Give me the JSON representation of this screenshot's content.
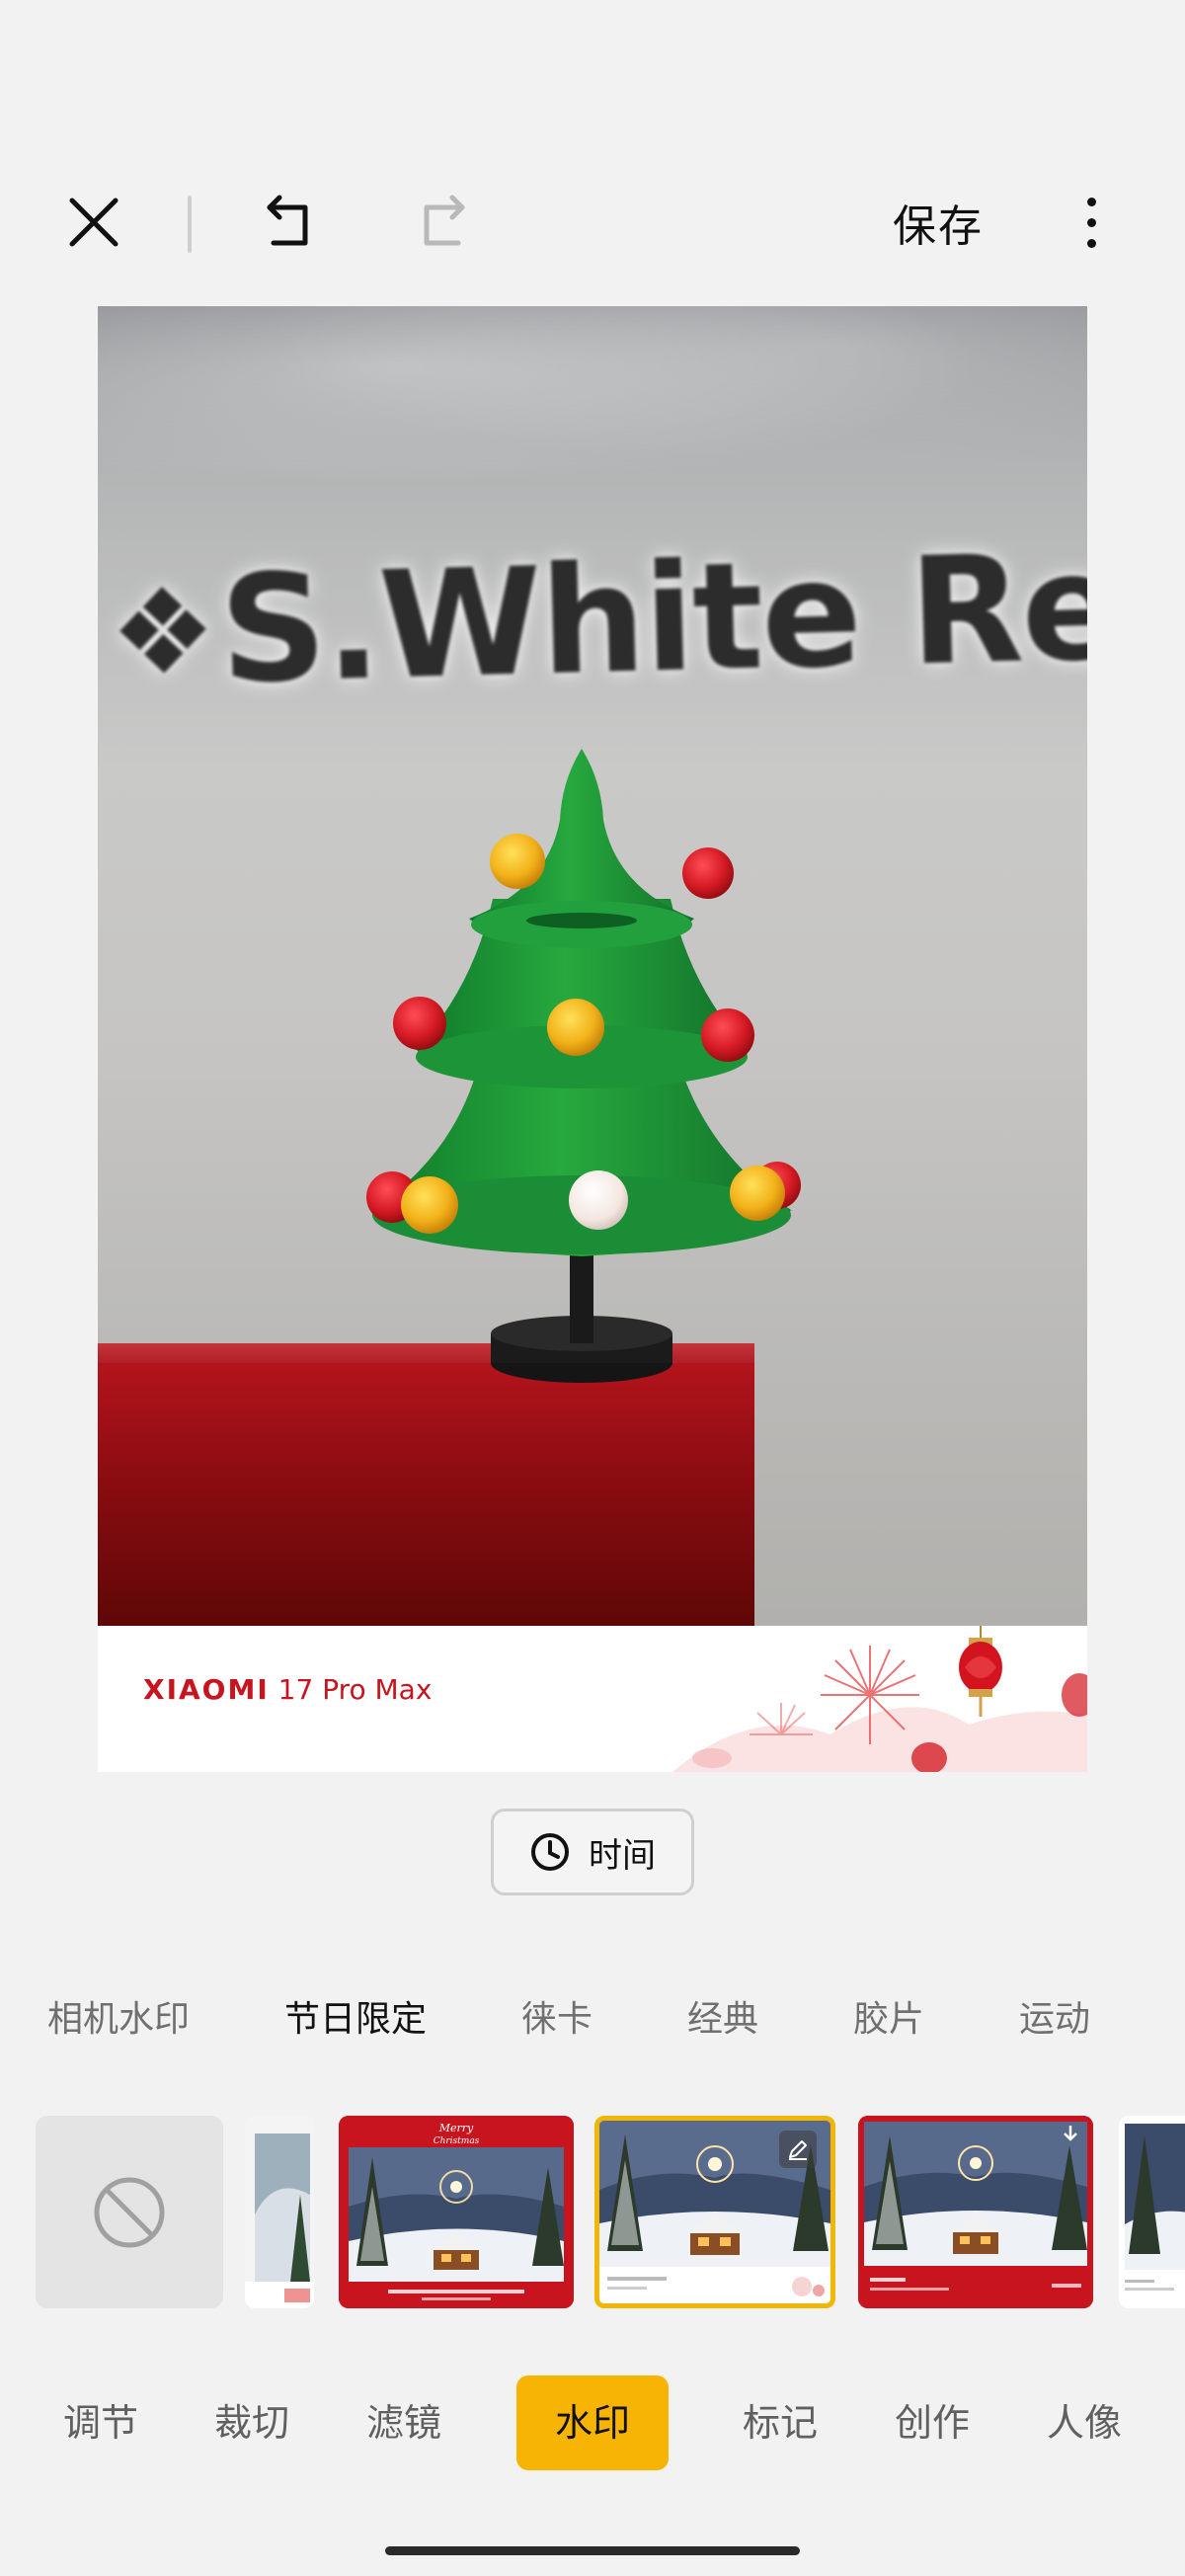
{
  "toolbar": {
    "save_label": "保存"
  },
  "photo": {
    "sign_text": "S.White Rev"
  },
  "watermark": {
    "brand_bold": "XIAOMI",
    "brand_model": "17 Pro Max"
  },
  "time_chip": {
    "label": "时间"
  },
  "categories": [
    {
      "label": "相机水印",
      "active": false
    },
    {
      "label": "节日限定",
      "active": true
    },
    {
      "label": "徕卡",
      "active": false
    },
    {
      "label": "经典",
      "active": false
    },
    {
      "label": "胶片",
      "active": false
    },
    {
      "label": "运动",
      "active": false
    }
  ],
  "tools": [
    {
      "label": "调节"
    },
    {
      "label": "裁切"
    },
    {
      "label": "滤镜"
    },
    {
      "label": "水印",
      "active": true
    },
    {
      "label": "标记"
    },
    {
      "label": "创作"
    },
    {
      "label": "人像"
    }
  ],
  "colors": {
    "accent": "#f8b404",
    "selected_border": "#f2b705",
    "brand_red": "#c8141e"
  }
}
